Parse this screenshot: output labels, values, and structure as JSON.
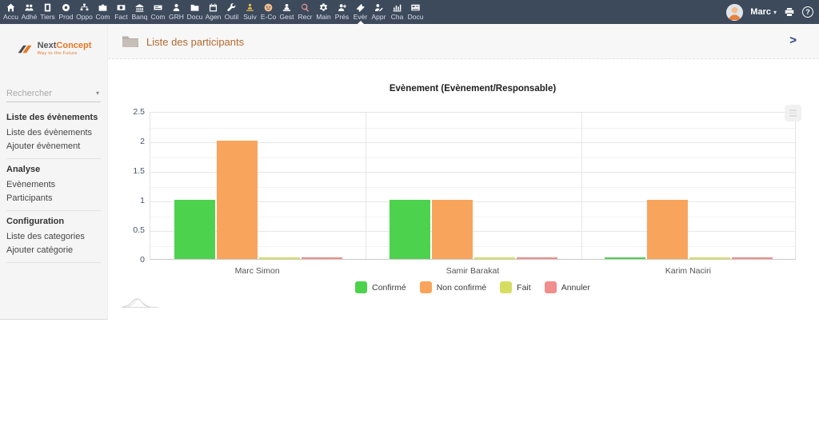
{
  "topnav": {
    "items": [
      {
        "label": "Accu",
        "icon": "home-icon"
      },
      {
        "label": "Adhé",
        "icon": "users-icon"
      },
      {
        "label": "Tiers",
        "icon": "door-icon"
      },
      {
        "label": "Prod",
        "icon": "product-icon"
      },
      {
        "label": "Oppo",
        "icon": "sitemap-icon"
      },
      {
        "label": "Com",
        "icon": "briefcase-icon"
      },
      {
        "label": "Fact",
        "icon": "invoice-icon"
      },
      {
        "label": "Banq",
        "icon": "bank-icon"
      },
      {
        "label": "Com",
        "icon": "cheque-icon"
      },
      {
        "label": "GRH",
        "icon": "person-icon"
      },
      {
        "label": "Docu",
        "icon": "folder-icon"
      },
      {
        "label": "Agen",
        "icon": "calendar-icon"
      },
      {
        "label": "Outil",
        "icon": "wrench-icon"
      },
      {
        "label": "Suiv",
        "icon": "worker-icon",
        "color": "#e5b94d"
      },
      {
        "label": "E-Co",
        "icon": "face-icon",
        "color": "#f2bd8f"
      },
      {
        "label": "Gest",
        "icon": "person-desk-icon"
      },
      {
        "label": "Recr",
        "icon": "search-person-icon",
        "color": "#e09090"
      },
      {
        "label": "Main",
        "icon": "gear-icon"
      },
      {
        "label": "Prés",
        "icon": "person-plus-icon"
      },
      {
        "label": "Evèr",
        "icon": "ticket-icon"
      },
      {
        "label": "Appr",
        "icon": "person-pen-icon"
      },
      {
        "label": "Cha",
        "icon": "chart-icon"
      },
      {
        "label": "Docu",
        "icon": "card-icon"
      }
    ],
    "active_index": 19,
    "user": {
      "name": "Marc"
    }
  },
  "icons": {
    "user_caret": "▾",
    "search_caret": "▾",
    "help_glyph": "?",
    "breadcrumb_chevron": ">"
  },
  "sidebar": {
    "logo": {
      "brand_prefix": "Next",
      "brand_suffix": "Concept",
      "tagline": "Way to the Future"
    },
    "search_placeholder": "Rechercher",
    "sections": [
      {
        "title": "Liste des évènements",
        "items": [
          "Liste des évènements",
          "Ajouter évènement"
        ]
      },
      {
        "title": "Analyse",
        "items": [
          "Evènements",
          "Participants"
        ]
      },
      {
        "title": "Configuration",
        "items": [
          "Liste des categories",
          "Ajouter catégorie"
        ]
      }
    ]
  },
  "header": {
    "title": "Liste des participants"
  },
  "chart_data": {
    "type": "bar",
    "title": "Evènement (Evènement/Responsable)",
    "categories": [
      "Marc Simon",
      "Samir Barakat",
      "Karim Naciri"
    ],
    "series": [
      {
        "name": "Confirmé",
        "color": "#4dd24d",
        "values": [
          1,
          1,
          0
        ]
      },
      {
        "name": "Non confirmé",
        "color": "#f9a45c",
        "values": [
          2,
          1,
          1
        ]
      },
      {
        "name": "Fait",
        "color": "#d6de62",
        "values": [
          0,
          0,
          0
        ]
      },
      {
        "name": "Annuler",
        "color": "#f08d8d",
        "values": [
          0,
          0,
          0
        ]
      }
    ],
    "ylim": [
      0,
      2.5
    ],
    "yticks": [
      "0",
      "0.5",
      "1",
      "1.5",
      "2",
      "2.5"
    ],
    "ytick_step": 0.5,
    "grid": true,
    "legend_position": "bottom"
  },
  "colors": {
    "navbar_bg": "#3c4a5c",
    "accent_orange": "#e87722",
    "page_title": "#b4682e",
    "sidebar_bg": "#f5f5f5"
  }
}
